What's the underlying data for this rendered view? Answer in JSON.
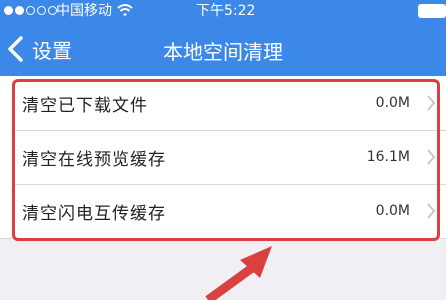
{
  "status_bar": {
    "carrier": "中国移动",
    "time": "下午5:22"
  },
  "nav": {
    "back_label": "设置",
    "title": "本地空间清理"
  },
  "rows": [
    {
      "label": "清空已下载文件",
      "value": "0.0M"
    },
    {
      "label": "清空在线预览缓存",
      "value": "16.1M"
    },
    {
      "label": "清空闪电互传缓存",
      "value": "0.0M"
    }
  ],
  "colors": {
    "header": "#3b88e8",
    "background": "#efeff4",
    "highlight": "#d9403f"
  },
  "icons": [
    "signal-icon",
    "wifi-icon",
    "battery-icon",
    "back-chevron-icon",
    "chevron-right-icon",
    "annotation-arrow-icon"
  ]
}
